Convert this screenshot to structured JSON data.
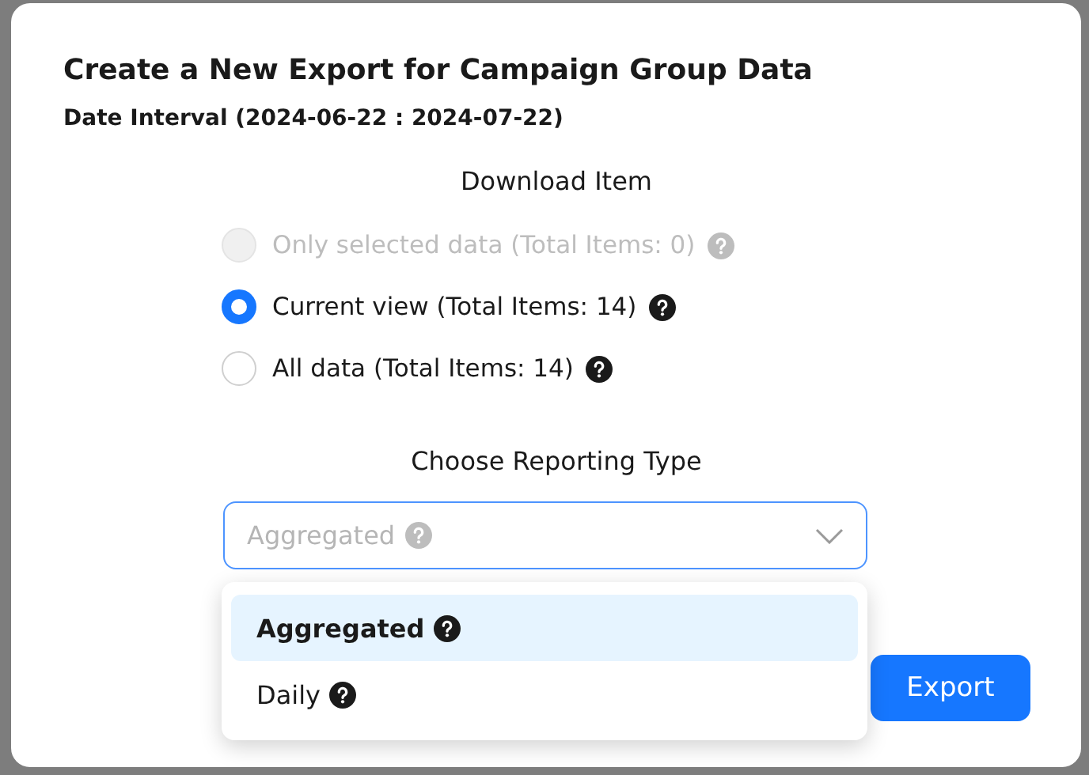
{
  "dialog": {
    "title": "Create a New Export for Campaign Group Data",
    "subtitle": "Date Interval (2024-06-22 : 2024-07-22)"
  },
  "download_item": {
    "heading": "Download Item",
    "options": [
      {
        "label": "Only selected data (Total Items: 0)",
        "selected": false,
        "disabled": true
      },
      {
        "label": "Current view (Total Items: 14)",
        "selected": true,
        "disabled": false
      },
      {
        "label": "All data (Total Items: 14)",
        "selected": false,
        "disabled": false
      }
    ]
  },
  "reporting_type": {
    "heading": "Choose Reporting Type",
    "select": {
      "value": "Aggregated",
      "expanded": true
    },
    "options": [
      {
        "label": "Aggregated",
        "selected": true
      },
      {
        "label": "Daily",
        "selected": false
      }
    ]
  },
  "buttons": {
    "export": "Export"
  }
}
